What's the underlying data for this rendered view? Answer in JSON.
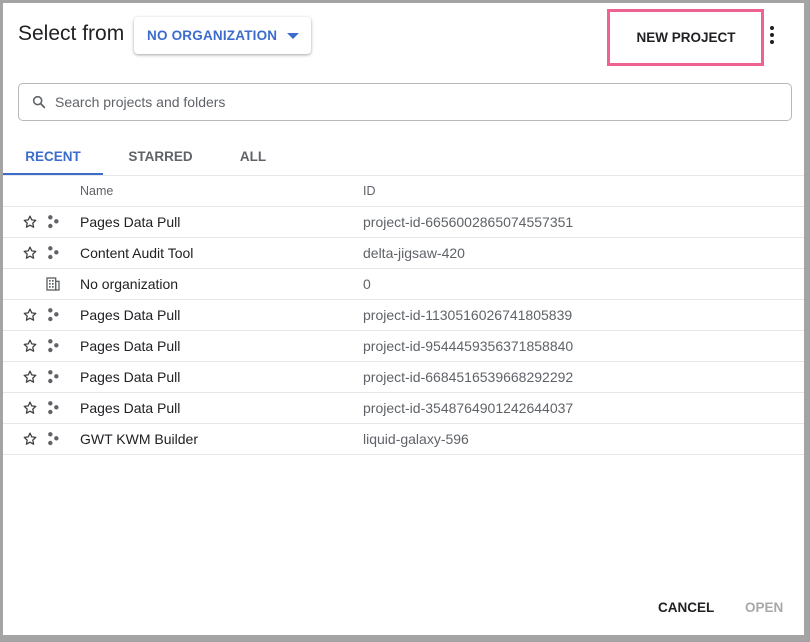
{
  "header": {
    "title": "Select from",
    "org_selector": {
      "label": "NO ORGANIZATION",
      "icon": "arrow-drop-down-icon"
    },
    "new_project_label": "NEW PROJECT",
    "more_icon": "more-vert-icon"
  },
  "search": {
    "placeholder": "Search projects and folders",
    "value": "",
    "icon": "search-icon"
  },
  "tabs": [
    {
      "label": "RECENT",
      "active": true
    },
    {
      "label": "STARRED",
      "active": false
    },
    {
      "label": "ALL",
      "active": false
    }
  ],
  "table": {
    "columns": {
      "name": "Name",
      "id": "ID"
    },
    "rows": [
      {
        "name": "Pages Data Pull",
        "id": "project-id-6656002865074557351",
        "type": "project",
        "starred": false
      },
      {
        "name": "Content Audit Tool",
        "id": "delta-jigsaw-420",
        "type": "project",
        "starred": false
      },
      {
        "name": "No organization",
        "id": "0",
        "type": "organization",
        "starred": null
      },
      {
        "name": "Pages Data Pull",
        "id": "project-id-1130516026741805839",
        "type": "project",
        "starred": false
      },
      {
        "name": "Pages Data Pull",
        "id": "project-id-9544459356371858840",
        "type": "project",
        "starred": false
      },
      {
        "name": "Pages Data Pull",
        "id": "project-id-6684516539668292292",
        "type": "project",
        "starred": false
      },
      {
        "name": "Pages Data Pull",
        "id": "project-id-3548764901242644037",
        "type": "project",
        "starred": false
      },
      {
        "name": "GWT KWM Builder",
        "id": "liquid-galaxy-596",
        "type": "project",
        "starred": false
      }
    ]
  },
  "footer": {
    "cancel_label": "CANCEL",
    "open_label": "OPEN",
    "open_enabled": false
  },
  "colors": {
    "accent": "#3c6ccd",
    "highlight_border": "#f06292",
    "disabled_text": "#a8a8a8"
  }
}
